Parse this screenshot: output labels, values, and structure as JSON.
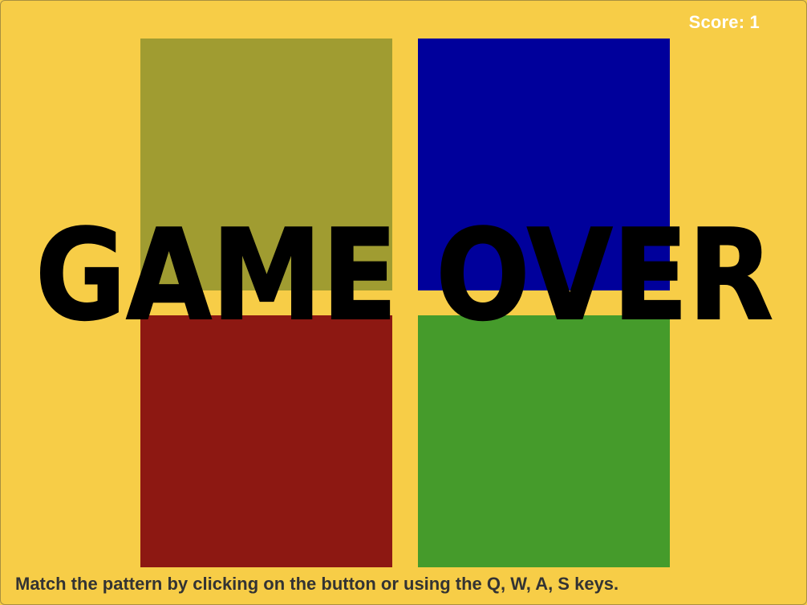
{
  "score": {
    "text": "Score: 1",
    "color": "#ffffff"
  },
  "pads": [
    {
      "key": "Q",
      "color": "#a09c31"
    },
    {
      "key": "W",
      "color": "#00009b"
    },
    {
      "key": "A",
      "color": "#8d1812"
    },
    {
      "key": "S",
      "color": "#459b2b"
    }
  ],
  "overlay": {
    "text": "GAME OVER"
  },
  "instructions": {
    "text": "Match the pattern by clicking on the button or using the Q, W, A, S keys."
  },
  "colors": {
    "background": "#f7cd47",
    "overlay_text": "#000000",
    "instructions_text": "#333333"
  }
}
